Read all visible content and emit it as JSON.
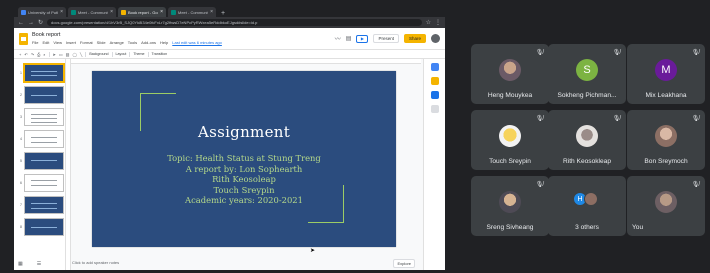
{
  "browser": {
    "tabs": [
      {
        "label": "University of Puthisastra – Co",
        "color": "#4285f4",
        "active": false
      },
      {
        "label": "Meet - Community Health Sc",
        "color": "#00897b",
        "active": false
      },
      {
        "label": "Book report - Google Slides",
        "color": "#f4b400",
        "active": true
      },
      {
        "label": "Meet - Community Health",
        "color": "#00897b",
        "active": false
      }
    ],
    "url": "docs.google.com/presentation/d/1hV3rB_SJQ0Yk8I34e0fcFxLr7g2ftwsD7eNPcPyRWxea5eRddbkoEJgsd#slide=id.p"
  },
  "slides_app": {
    "doc_title": "Book report",
    "menus": [
      "File",
      "Edit",
      "View",
      "Insert",
      "Format",
      "Slide",
      "Arrange",
      "Tools",
      "Add-ons",
      "Help"
    ],
    "last_edit": "Last edit was 6 minutes ago",
    "present_label": "Present",
    "share_label": "Share",
    "toolbar": {
      "background": "Background",
      "layout": "Layout",
      "theme": "Theme",
      "transition": "Transition"
    },
    "speaker_notes": "Click to add speaker notes",
    "explore_label": "Explore"
  },
  "slide": {
    "title": "Assignment",
    "lines": [
      "Topic: Health Status at Stung Treng",
      "A report by: Lon Sophearth",
      "Rith Keosoleap",
      "Touch Sreypin",
      "Academic years: 2020-2021"
    ]
  },
  "participants": [
    {
      "name": "Heng Mouykea",
      "initial": "",
      "avatar_color": "",
      "photo": "photo-a"
    },
    {
      "name": "Sokheng Pichman...",
      "initial": "S",
      "avatar_color": "#7cb342",
      "photo": ""
    },
    {
      "name": "Mix Leakhana",
      "initial": "M",
      "avatar_color": "#6a1b9a",
      "photo": ""
    },
    {
      "name": "Touch Sreypin",
      "initial": "",
      "avatar_color": "",
      "photo": "photo-b"
    },
    {
      "name": "Rith Keosokleap",
      "initial": "",
      "avatar_color": "",
      "photo": "photo-c"
    },
    {
      "name": "Bon Sreymoch",
      "initial": "",
      "avatar_color": "",
      "photo": "photo-d"
    },
    {
      "name": "Sreng Sivheang",
      "initial": "",
      "avatar_color": "",
      "photo": "photo-e"
    },
    {
      "name": "3 others",
      "initial": "",
      "avatar_color": "",
      "photo": ""
    },
    {
      "name": "You",
      "initial": "",
      "avatar_color": "",
      "photo": "photo-f"
    }
  ],
  "others_avatars": [
    {
      "initial": "H",
      "color": "#1e88e5"
    },
    {
      "initial": "",
      "color": "#8d6e63"
    }
  ],
  "colors": {
    "slide_bg": "#2b4c7e",
    "slide_accent": "#9ccc65",
    "meet_bg": "#202124",
    "tile_bg": "#3c4043",
    "share_button": "#f4b400"
  }
}
